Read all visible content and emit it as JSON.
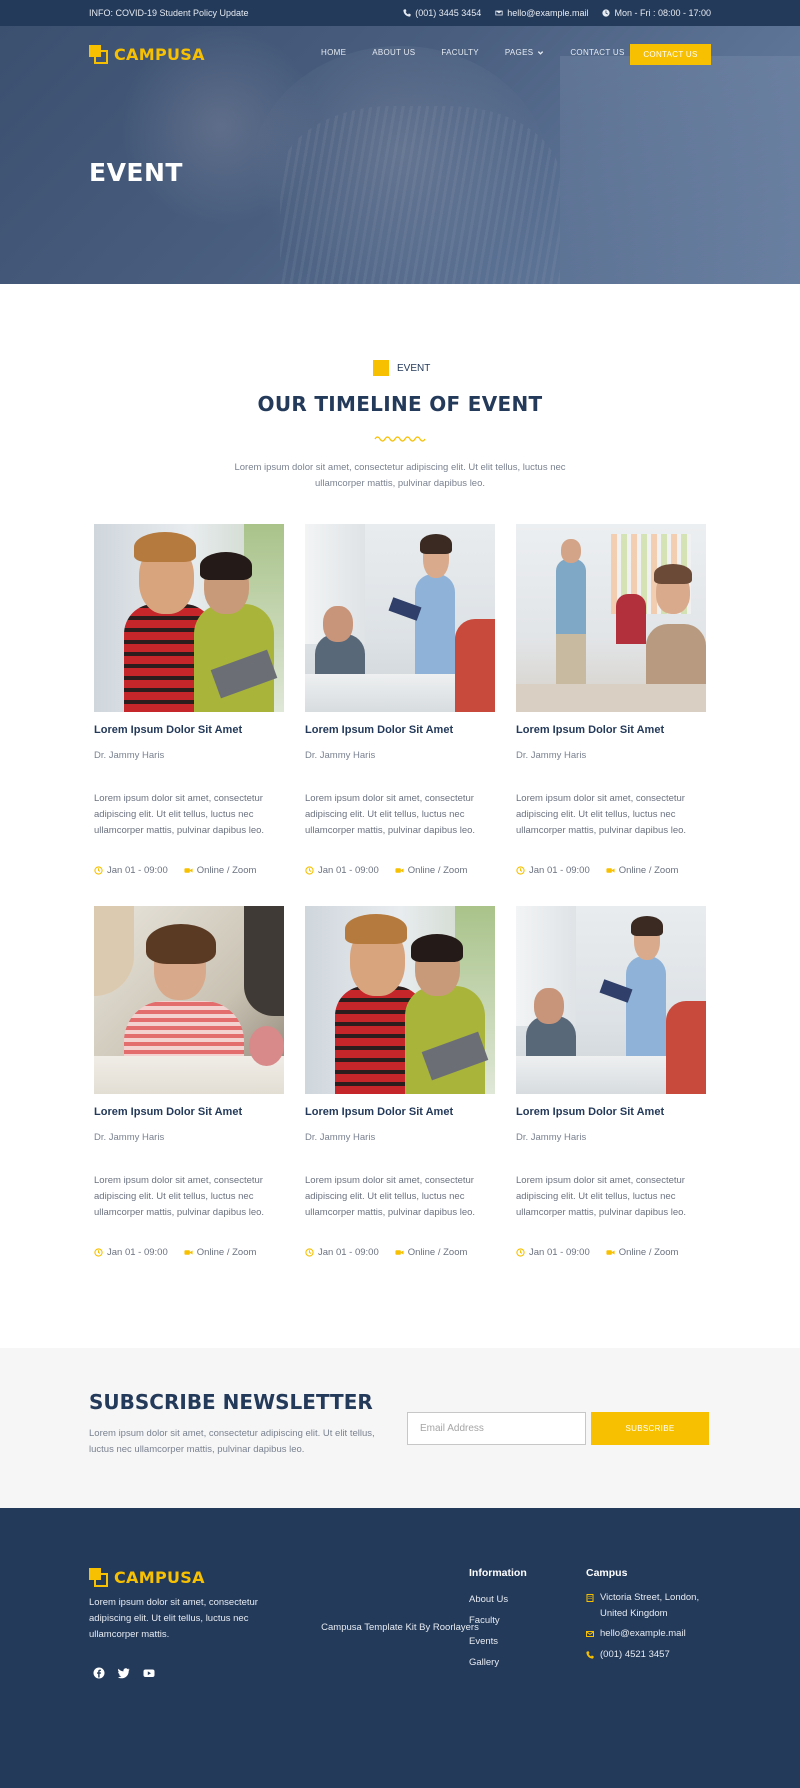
{
  "topbar": {
    "info": "INFO: COVID-19 Student Policy Update",
    "phone": "(001) 3445 3454",
    "email": "hello@example.mail",
    "hours": "Mon - Fri : 08:00 - 17:00"
  },
  "brand": {
    "name": "CAMPUSA"
  },
  "nav": {
    "items": [
      "HOME",
      "ABOUT US",
      "FACULTY",
      "PAGES",
      "CONTACT US"
    ],
    "cta": "CONTACT US"
  },
  "hero": {
    "title": "EVENT"
  },
  "section": {
    "eyebrow": "EVENT",
    "title": "OUR TIMELINE OF EVENT",
    "description": "Lorem ipsum dolor sit amet, consectetur adipiscing elit. Ut elit tellus, luctus nec ullamcorper mattis, pulvinar dapibus leo."
  },
  "events": [
    {
      "title": "Lorem Ipsum Dolor Sit Amet",
      "author": "Dr. Jammy Haris",
      "description": "Lorem ipsum dolor sit amet, consectetur adipiscing elit. Ut elit tellus, luctus nec ullamcorper mattis, pulvinar dapibus leo.",
      "date": "Jan 01 - 09:00",
      "location": "Online / Zoom"
    },
    {
      "title": "Lorem Ipsum Dolor Sit Amet",
      "author": "Dr. Jammy Haris",
      "description": "Lorem ipsum dolor sit amet, consectetur adipiscing elit. Ut elit tellus, luctus nec ullamcorper mattis, pulvinar dapibus leo.",
      "date": "Jan 01 - 09:00",
      "location": "Online / Zoom"
    },
    {
      "title": "Lorem Ipsum Dolor Sit Amet",
      "author": "Dr. Jammy Haris",
      "description": "Lorem ipsum dolor sit amet, consectetur adipiscing elit. Ut elit tellus, luctus nec ullamcorper mattis, pulvinar dapibus leo.",
      "date": "Jan 01 - 09:00",
      "location": "Online / Zoom"
    },
    {
      "title": "Lorem Ipsum Dolor Sit Amet",
      "author": "Dr. Jammy Haris",
      "description": "Lorem ipsum dolor sit amet, consectetur adipiscing elit. Ut elit tellus, luctus nec ullamcorper mattis, pulvinar dapibus leo.",
      "date": "Jan 01 - 09:00",
      "location": "Online / Zoom"
    },
    {
      "title": "Lorem Ipsum Dolor Sit Amet",
      "author": "Dr. Jammy Haris",
      "description": "Lorem ipsum dolor sit amet, consectetur adipiscing elit. Ut elit tellus, luctus nec ullamcorper mattis, pulvinar dapibus leo.",
      "date": "Jan 01 - 09:00",
      "location": "Online / Zoom"
    },
    {
      "title": "Lorem Ipsum Dolor Sit Amet",
      "author": "Dr. Jammy Haris",
      "description": "Lorem ipsum dolor sit amet, consectetur adipiscing elit. Ut elit tellus, luctus nec ullamcorper mattis, pulvinar dapibus leo.",
      "date": "Jan 01 - 09:00",
      "location": "Online / Zoom"
    }
  ],
  "newsletter": {
    "title": "SUBSCRIBE NEWSLETTER",
    "description": "Lorem ipsum dolor sit amet, consectetur adipiscing elit. Ut elit tellus, luctus nec ullamcorper mattis, pulvinar dapibus leo.",
    "placeholder": "Email Address",
    "button": "SUBSCRIBE"
  },
  "footer": {
    "about": "Lorem ipsum dolor sit amet, consectetur adipiscing elit. Ut elit tellus, luctus nec ullamcorper mattis.",
    "social_icons": [
      "facebook-icon",
      "twitter-icon",
      "youtube-icon"
    ],
    "information": {
      "title": "Information",
      "links": [
        "About Us",
        "Faculty",
        "Events",
        "Gallery"
      ]
    },
    "campus": {
      "title": "Campus",
      "address": "Victoria Street, London, United Kingdom",
      "email": "hello@example.mail",
      "phone": "(001) 4521 3457"
    },
    "copyright": "Campusa Template Kit By Roorlayers"
  },
  "colors": {
    "primary": "#243a5a",
    "accent": "#f7c000"
  }
}
